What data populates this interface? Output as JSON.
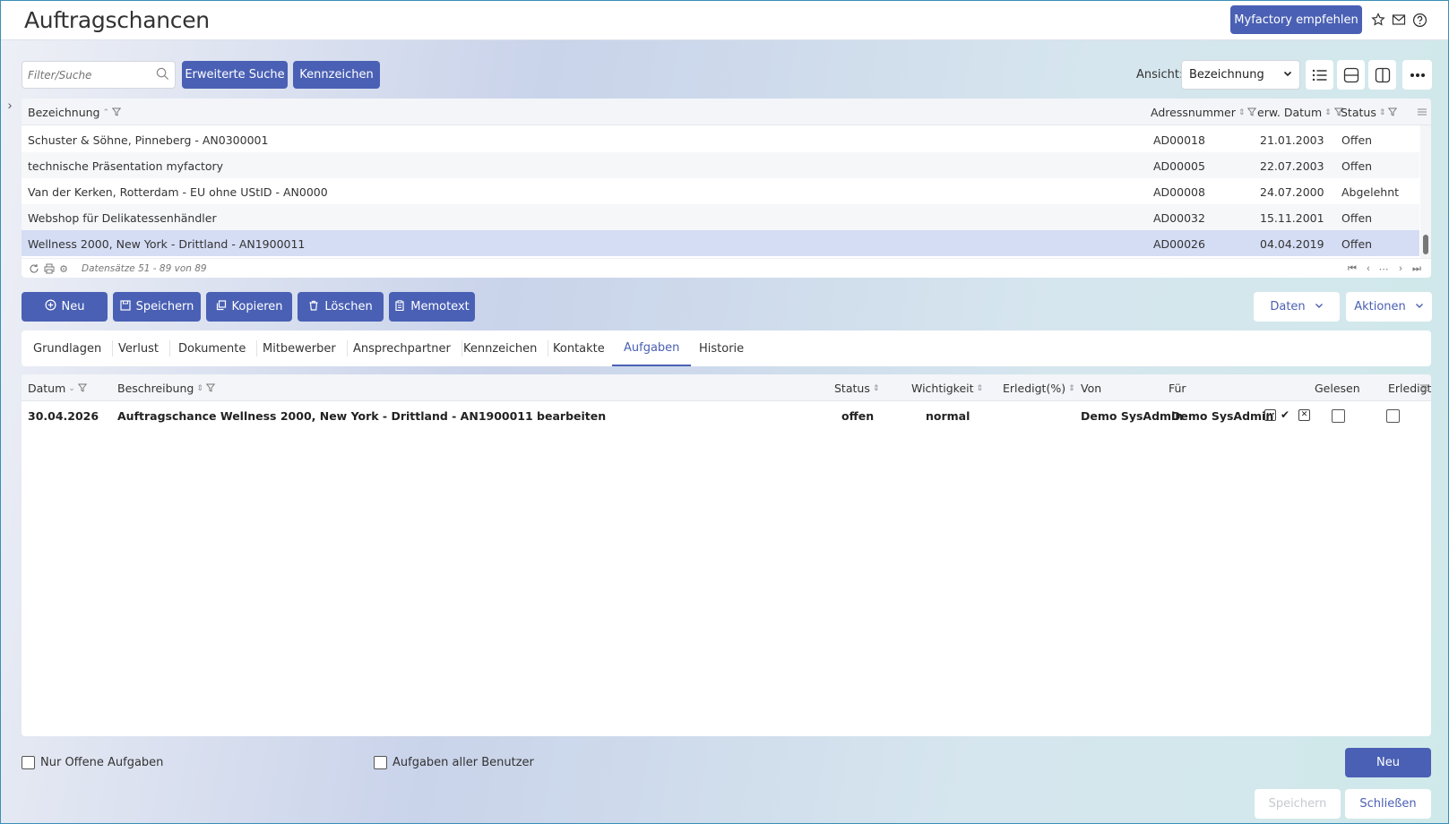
{
  "header": {
    "title": "Auftragschancen",
    "recommend_label": "Myfactory empfehlen"
  },
  "toolbar": {
    "search_placeholder": "Filter/Suche",
    "advanced_search_label": "Erweiterte Suche",
    "tags_label": "Kennzeichen",
    "view_label": "Ansicht:",
    "view_value": "Bezeichnung"
  },
  "grid": {
    "columns": {
      "name": "Bezeichnung",
      "address": "Adressnummer",
      "date": "erw. Datum",
      "status": "Status"
    },
    "rows": [
      {
        "name": "Schuster & Söhne, Pinneberg - AN0300001",
        "address": "AD00018",
        "date": "21.01.2003",
        "status": "Offen"
      },
      {
        "name": "technische Präsentation myfactory",
        "address": "AD00005",
        "date": "22.07.2003",
        "status": "Offen"
      },
      {
        "name": "Van der Kerken, Rotterdam - EU ohne UStID - AN0000",
        "address": "AD00008",
        "date": "24.07.2000",
        "status": "Abgelehnt"
      },
      {
        "name": "Webshop für Delikatessenhändler",
        "address": "AD00032",
        "date": "15.11.2001",
        "status": "Offen"
      },
      {
        "name": "Wellness 2000, New York - Drittland - AN1900011",
        "address": "AD00026",
        "date": "04.04.2019",
        "status": "Offen"
      }
    ],
    "record_count": "Datensätze 51 - 89 von 89"
  },
  "actions": {
    "new_label": "Neu",
    "save_label": "Speichern",
    "copy_label": "Kopieren",
    "delete_label": "Löschen",
    "memo_label": "Memotext",
    "data_label": "Daten",
    "actions_label": "Aktionen"
  },
  "tabs": [
    {
      "label": "Grundlagen"
    },
    {
      "label": "Verlust"
    },
    {
      "label": "Dokumente"
    },
    {
      "label": "Mitbewerber"
    },
    {
      "label": "Ansprechpartner"
    },
    {
      "label": "Kennzeichen"
    },
    {
      "label": "Kontakte"
    },
    {
      "label": "Aufgaben",
      "active": true
    },
    {
      "label": "Historie"
    }
  ],
  "tasks": {
    "columns": {
      "date": "Datum",
      "description": "Beschreibung",
      "status": "Status",
      "priority": "Wichtigkeit",
      "done_pct": "Erledigt(%)",
      "from": "Von",
      "for": "Für",
      "read": "Gelesen",
      "done": "Erledigt"
    },
    "rows": [
      {
        "date": "30.04.2026",
        "description": "Auftragschance Wellness 2000, New York - Drittland - AN1900011 bearbeiten",
        "status": "offen",
        "priority": "normal",
        "done_pct": "",
        "from": "Demo SysAdmin",
        "for": "Demo SysAdmin",
        "read": false,
        "done": false
      }
    ]
  },
  "bottom": {
    "only_open_label": "Nur Offene Aufgaben",
    "all_users_label": "Aufgaben aller Benutzer",
    "new_label": "Neu",
    "save_label": "Speichern",
    "close_label": "Schließen"
  },
  "colors": {
    "primary": "#4a60b4",
    "selected_row": "#d5ddf5"
  }
}
